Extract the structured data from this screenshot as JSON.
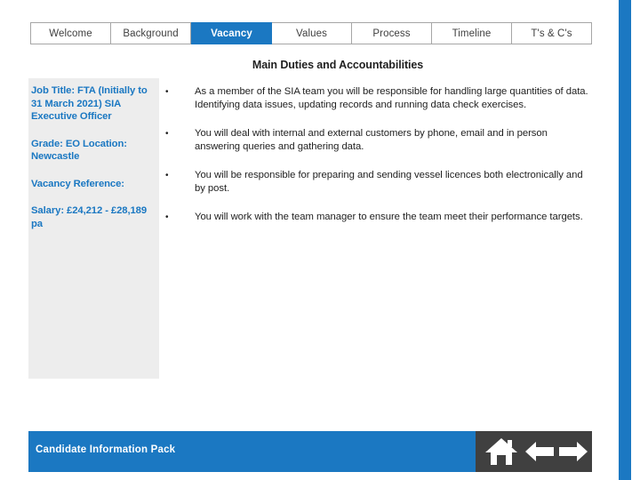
{
  "tabs": [
    {
      "label": "Welcome",
      "active": false
    },
    {
      "label": "Background",
      "active": false
    },
    {
      "label": "Vacancy",
      "active": true
    },
    {
      "label": "Values",
      "active": false
    },
    {
      "label": "Process",
      "active": false
    },
    {
      "label": "Timeline",
      "active": false
    },
    {
      "label": "T's & C's",
      "active": false
    }
  ],
  "section": {
    "title": "Main Duties and Accountabilities"
  },
  "details": [
    "Job Title: FTA (Initially to 31 March 2021) SIA Executive Officer",
    "Grade: EO Location: Newcastle",
    "Vacancy Reference:",
    "Salary: £24,212 - £28,189 pa"
  ],
  "bullets": [
    {
      "marker": "•",
      "text": "As a member of the SIA team you will be responsible for handling large quantities of data. Identifying data issues, updating records and running data check exercises."
    },
    {
      "marker": "•",
      "text": "You will deal with internal and external customers by phone, email and in person answering queries and gathering data."
    },
    {
      "marker": "•",
      "text": "You will be responsible for preparing and sending vessel licences both electronically and by post."
    },
    {
      "marker": "•",
      "text": "You will work with the team manager to ensure the team meet their performance targets."
    }
  ],
  "footer": {
    "label": "Candidate Information Pack",
    "icons": [
      "home-icon",
      "arrow-left-icon",
      "arrow-right-icon"
    ]
  },
  "colors": {
    "accent": "#1b78c2",
    "panel": "#ededed",
    "footer_icon_bg": "#404040"
  }
}
